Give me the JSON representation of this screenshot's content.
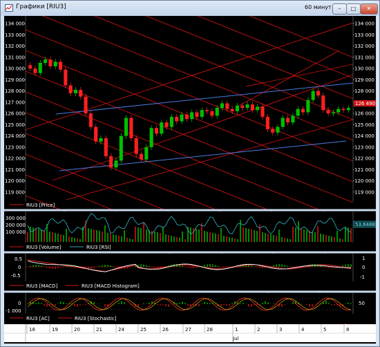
{
  "window": {
    "title": "Графики [RIU3]",
    "timeframe": "60 минут",
    "buttons": {
      "minimize": "–",
      "maximize": "□",
      "close": "✕"
    }
  },
  "colors": {
    "background": "#000000",
    "bull": "#00c000",
    "bear": "#ff2020",
    "channel_red": "#d01515",
    "trend_blue": "#4a7be0",
    "rsi": "#2aa8b4",
    "macd": "#ff3030",
    "signal": "#ffffff",
    "stochastic_k": "#ff3030",
    "stochastic_d": "#ffd000"
  },
  "price_axis": {
    "ticks": [
      "134 000",
      "133 000",
      "132 000",
      "131 000",
      "130 000",
      "129 000",
      "128 000",
      "127 000",
      "126 000",
      "125 000",
      "124 000",
      "123 000",
      "122 000",
      "121 000",
      "120 000",
      "119 000"
    ],
    "ylim": [
      118500,
      134500
    ]
  },
  "current_price_tag": "126 490",
  "rsi_value_tag": "53,6488",
  "volume_axis": {
    "ticks": [
      "300 000",
      "200 000",
      "100 000"
    ]
  },
  "macd_axis": {
    "left": [
      "0.5",
      "0",
      "-0.5"
    ],
    "right": [
      "1",
      "0",
      "-1"
    ]
  },
  "ac_axis": {
    "left": [
      "0",
      "-1 000"
    ],
    "right": [
      "50"
    ]
  },
  "legends": {
    "price": "RIU3 [Price]",
    "volume": "RIU3 [Volume]",
    "rsi": "RIU3 [RSI]",
    "macd": "RIU3 [MACD]",
    "macd_hist": "RIU3 [MACD Histogram]",
    "ac": "RIU3 [AC]",
    "stochastic": "RIU3 [Stochastic]"
  },
  "dates": [
    "18",
    "19",
    "20",
    "21",
    "24",
    "25",
    "26",
    "27",
    "28",
    "1",
    "2",
    "3",
    "4",
    "5",
    "8"
  ],
  "month_label": "Jul",
  "chart_data": {
    "type": "candlestick",
    "series_name": "RIU3",
    "closes": [
      130000,
      129600,
      130500,
      130800,
      130200,
      130600,
      129900,
      128500,
      127800,
      128100,
      127500,
      126000,
      124800,
      123500,
      123800,
      122200,
      121200,
      121800,
      124000,
      125600,
      123800,
      122400,
      121900,
      123000,
      124700,
      124200,
      125200,
      124800,
      125700,
      125300,
      125900,
      125500,
      126100,
      125700,
      126300,
      126200,
      125800,
      126500,
      126900,
      126400,
      126200,
      126700,
      126500,
      126800,
      126300,
      126600,
      125700,
      124600,
      124300,
      124800,
      125600,
      125200,
      125800,
      126400,
      126100,
      127200,
      128000,
      127600,
      126300,
      126000,
      126100,
      126400,
      126300,
      126490
    ],
    "ylim": [
      118500,
      134500
    ]
  }
}
